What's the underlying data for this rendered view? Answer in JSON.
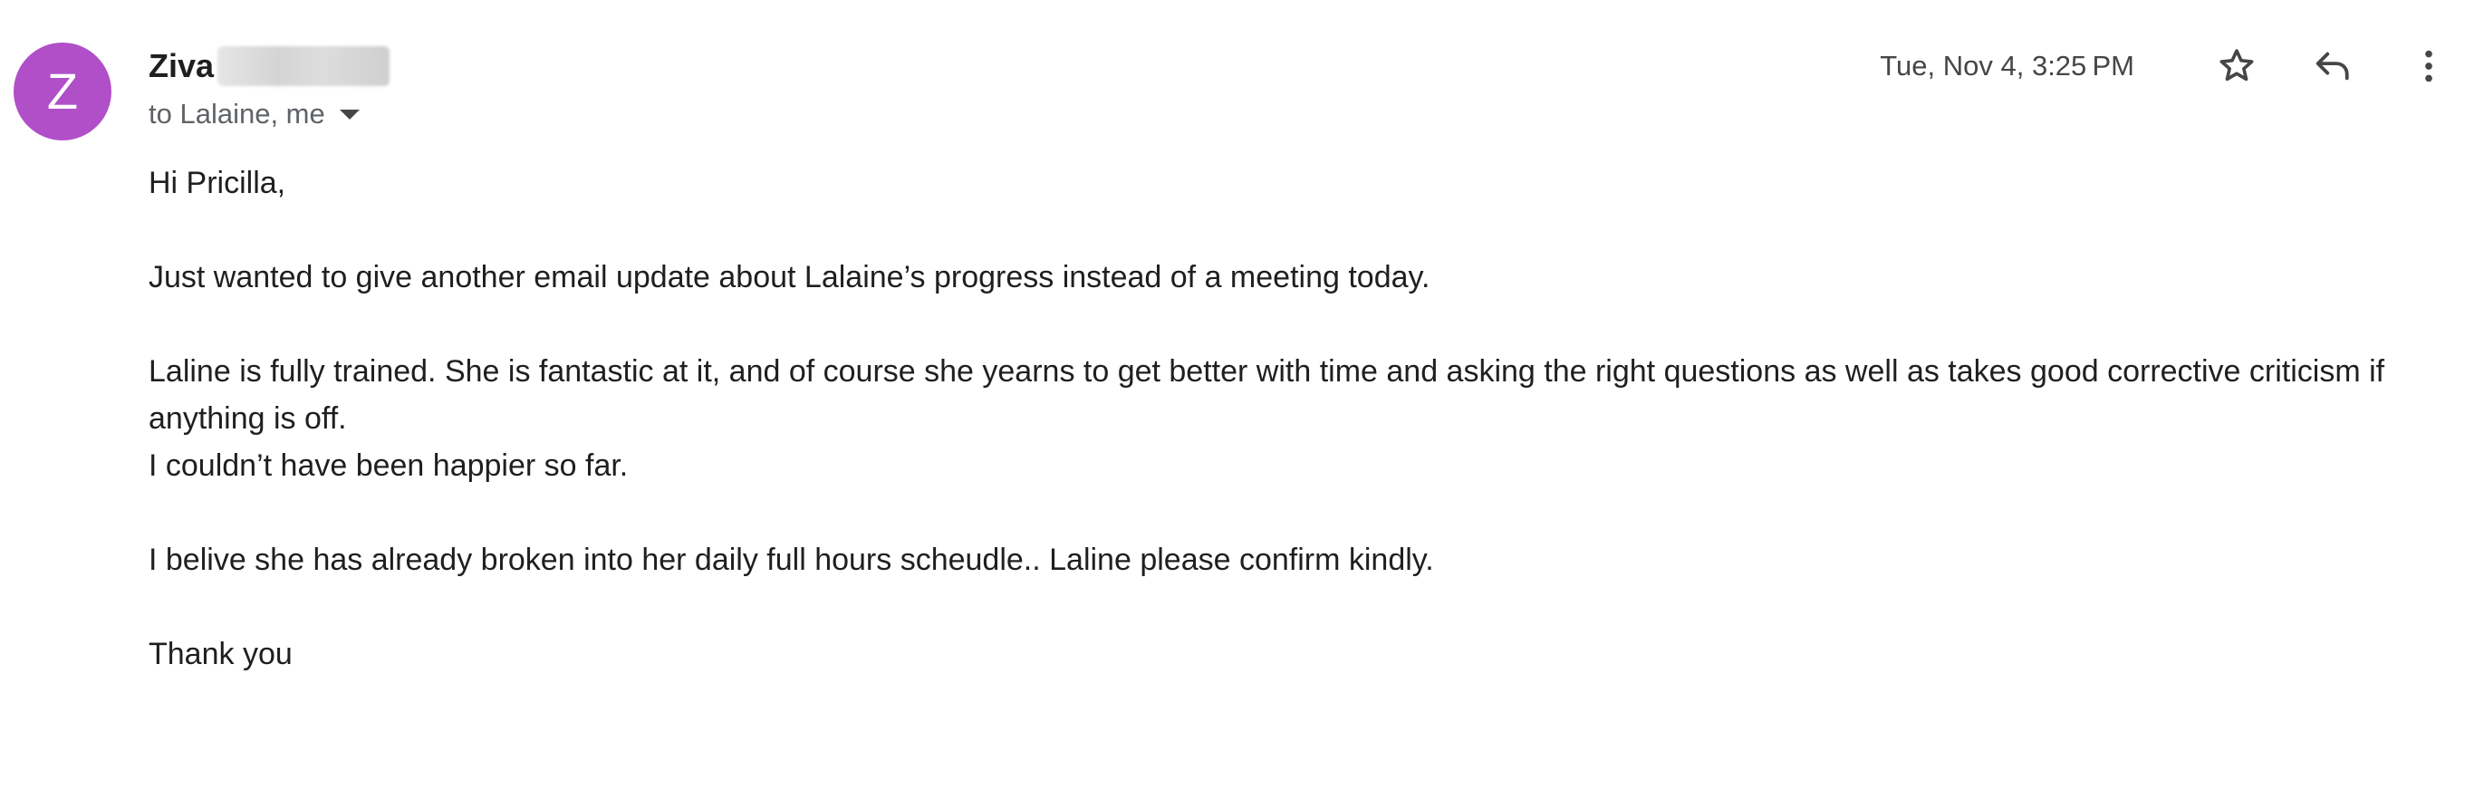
{
  "sender": {
    "initial": "Z",
    "name": "Ziva",
    "avatar_color": "#b04fc8"
  },
  "recipients": {
    "label": "to Lalaine, me"
  },
  "meta": {
    "timestamp": "Tue, Nov 4, 3:25 PM"
  },
  "icons": {
    "star": "star-icon",
    "reply": "reply-icon",
    "more": "more-vert-icon",
    "caret": "caret-down-icon"
  },
  "body": {
    "greeting": "Hi Pricilla,",
    "p1": "Just wanted to give another email update about Lalaine’s progress instead of a meeting today.",
    "p2": "Laline is fully trained. She is fantastic at it, and of course she yearns to get better with time and asking the right questions as well as takes good corrective criticism if anything is off.",
    "p3": "I couldn’t have been happier so far.",
    "p4": "I belive she has already broken into her daily full hours scheudle.. Laline please confirm kindly.",
    "closing": "Thank you"
  }
}
